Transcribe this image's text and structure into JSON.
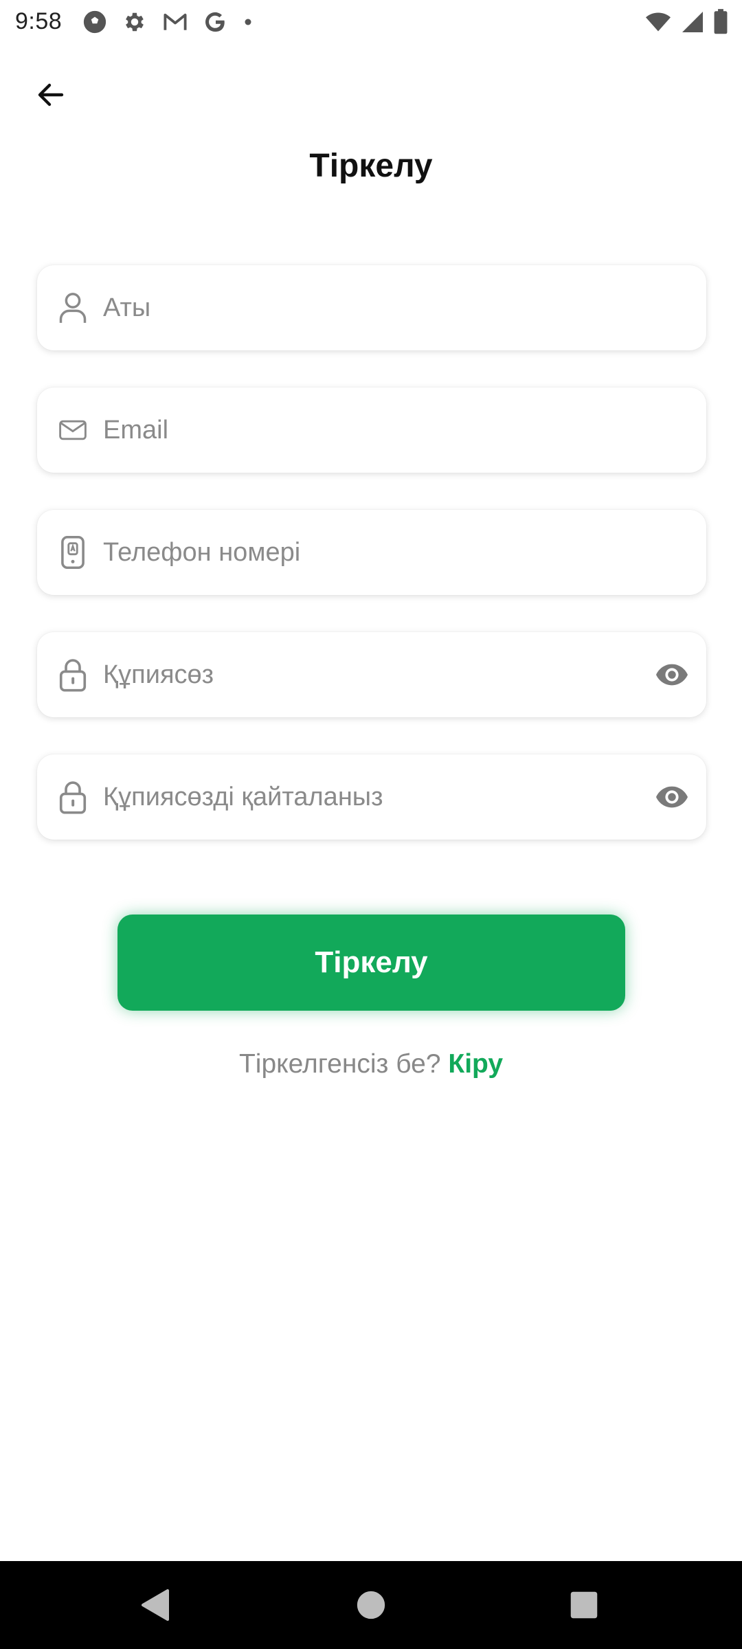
{
  "status_bar": {
    "time": "9:58",
    "left_icons": [
      "soccer-ball-icon",
      "gear-icon",
      "gmail-icon",
      "google-icon",
      "dot-icon"
    ],
    "right_icons": [
      "wifi-icon",
      "signal-icon",
      "battery-icon"
    ]
  },
  "header": {
    "title": "Тіркелу"
  },
  "form": {
    "name": {
      "placeholder": "Аты",
      "value": "",
      "icon": "person-icon"
    },
    "email": {
      "placeholder": "Email",
      "value": "",
      "icon": "mail-icon"
    },
    "phone": {
      "placeholder": "Телефон номері",
      "value": "",
      "icon": "phone-icon"
    },
    "password": {
      "placeholder": "Құпиясөз",
      "value": "",
      "icon": "lock-icon"
    },
    "password_repeat": {
      "placeholder": "Құпиясөзді қайталаныз",
      "value": "",
      "icon": "lock-icon"
    },
    "submit_label": "Тіркелу"
  },
  "footer": {
    "question": "Тіркелгенсіз бе?",
    "login_link": "Кіру"
  },
  "colors": {
    "accent": "#12a95a",
    "placeholder": "#8a8a8a",
    "nav_bar": "#000000"
  }
}
